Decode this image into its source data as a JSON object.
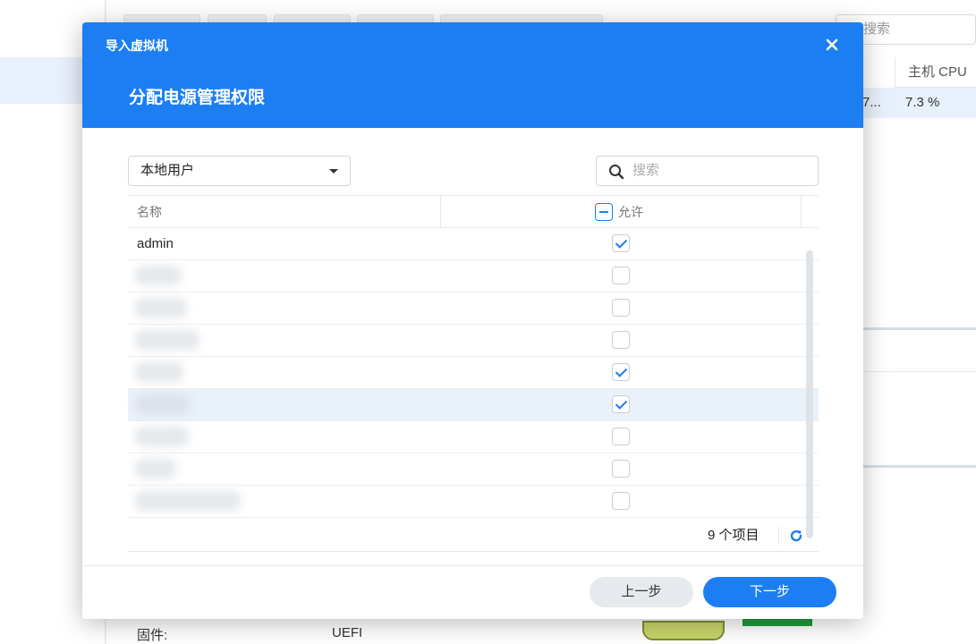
{
  "background": {
    "search_placeholder": "搜索",
    "column_header": "主机 CPU",
    "row_truncated": "7...",
    "row_cpu": "7.3 %",
    "firmware_label": "固件:",
    "firmware_value": "UEFI"
  },
  "modal": {
    "window_title": "导入虚拟机",
    "step_title": "分配电源管理权限",
    "user_type_select": "本地用户",
    "search_placeholder": "搜索",
    "columns": {
      "name": "名称",
      "allow": "允许"
    },
    "rows": [
      {
        "name": "admin",
        "allowed": true
      },
      {
        "name": "",
        "allowed": false
      },
      {
        "name": "",
        "allowed": false
      },
      {
        "name": "",
        "allowed": false
      },
      {
        "name": "",
        "allowed": true
      },
      {
        "name": "",
        "allowed": true
      },
      {
        "name": "",
        "allowed": false
      },
      {
        "name": "",
        "allowed": false
      },
      {
        "name": "",
        "allowed": false
      }
    ],
    "item_count": "9 个项目",
    "prev_button": "上一步",
    "next_button": "下一步"
  },
  "colors": {
    "accent": "#1c7ef2",
    "header_bg": "#1c7ef2",
    "selected_row": "#e9f1fb"
  },
  "icons": [
    "close-icon",
    "search-icon",
    "chevron-down-icon",
    "refresh-icon",
    "checkbox-icon"
  ]
}
